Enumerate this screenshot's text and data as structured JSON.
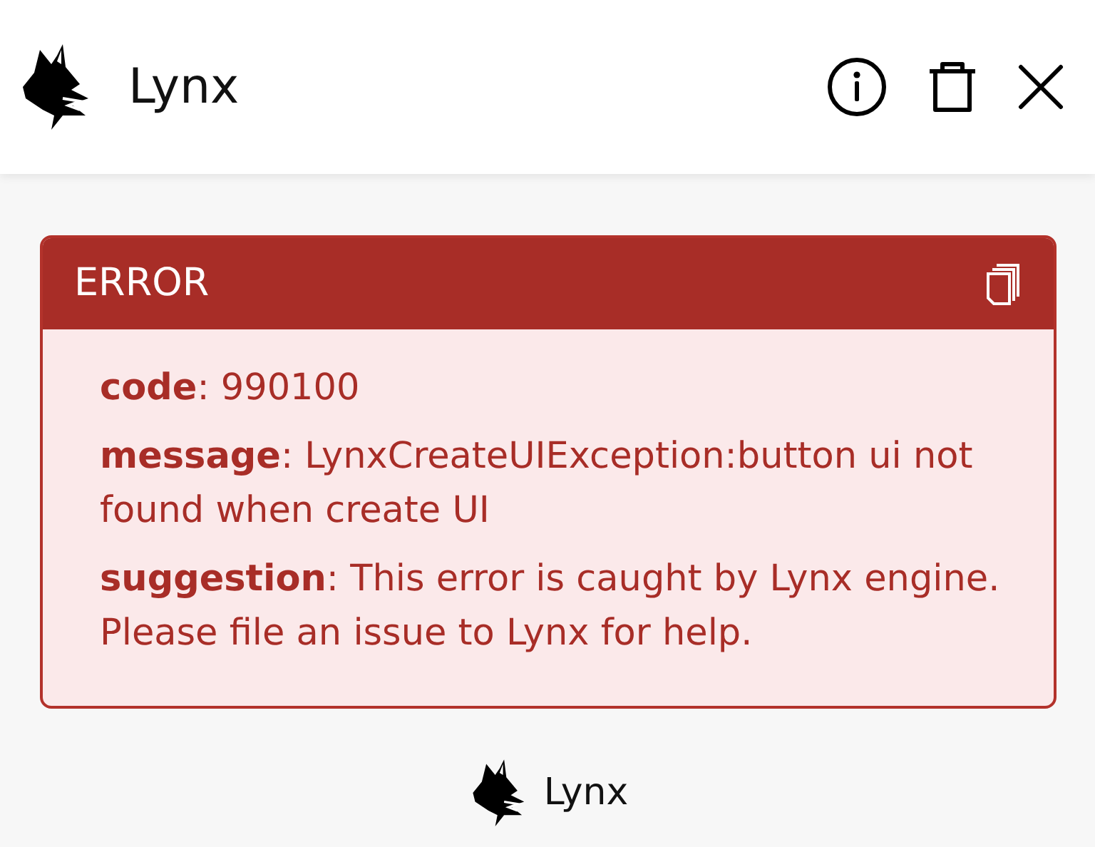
{
  "app_bar": {
    "title": "Lynx"
  },
  "error": {
    "heading": "ERROR",
    "fields": [
      {
        "text": "**code**: 990100"
      },
      {
        "text": "**message**: LynxCreateUIException:button ui not found when create UI"
      },
      {
        "text": "**suggestion**: This error is caught by Lynx engine. Please file an issue to Lynx for help."
      }
    ]
  },
  "footer": {
    "brand": "Lynx"
  }
}
